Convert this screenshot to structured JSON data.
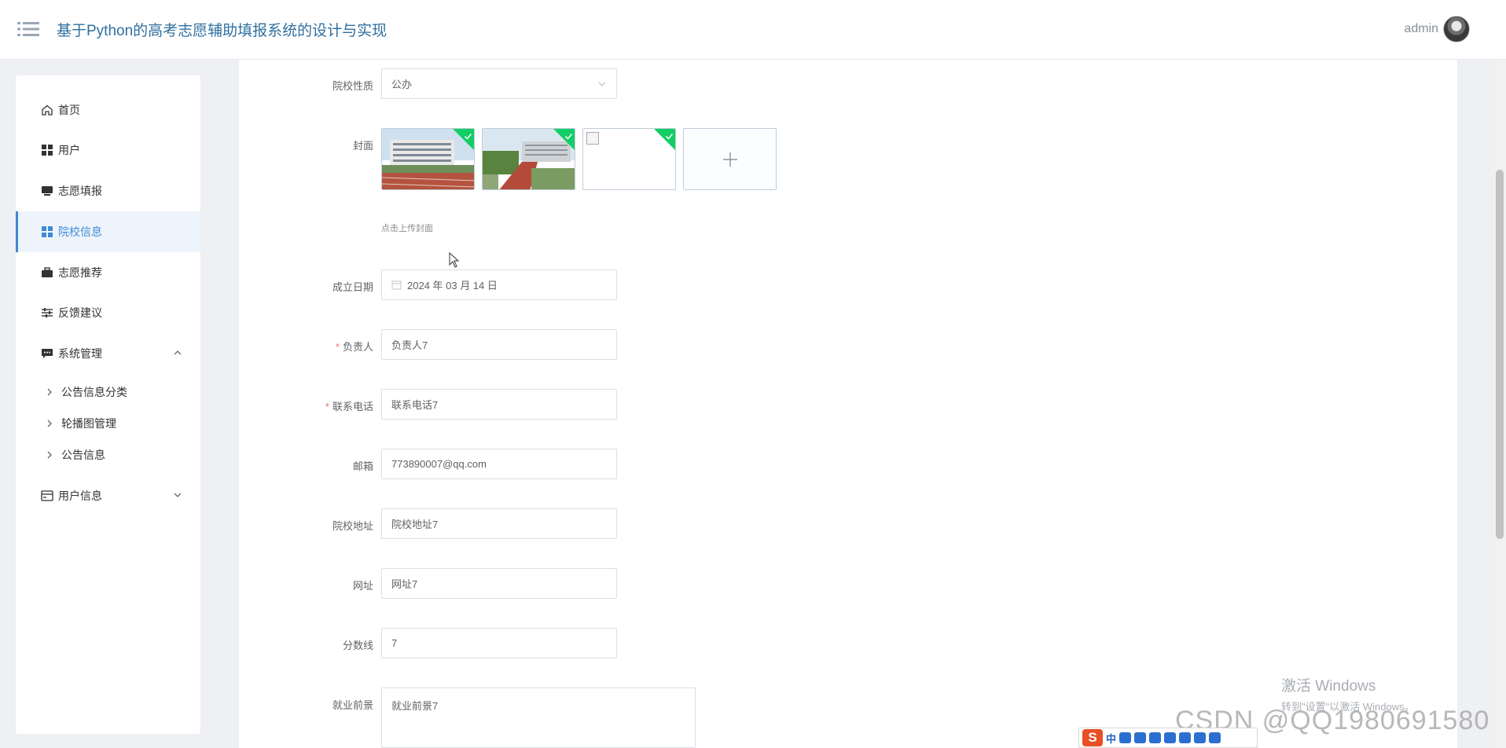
{
  "header": {
    "title": "基于Python的高考志愿辅助填报系统的设计与实现",
    "username": "admin"
  },
  "sidebar": {
    "items": [
      {
        "label": "首页",
        "icon": "home-icon"
      },
      {
        "label": "用户",
        "icon": "grid-icon"
      },
      {
        "label": "志愿填报",
        "icon": "monitor-icon"
      },
      {
        "label": "院校信息",
        "icon": "grid-icon",
        "active": true
      },
      {
        "label": "志愿推荐",
        "icon": "briefcase-icon"
      },
      {
        "label": "反馈建议",
        "icon": "sliders-icon"
      },
      {
        "label": "系统管理",
        "icon": "chat-icon",
        "expanded": true
      },
      {
        "label": "用户信息",
        "icon": "card-icon",
        "expanded": false
      }
    ],
    "sub_items": [
      "公告信息分类",
      "轮播图管理",
      "公告信息"
    ]
  },
  "form": {
    "nature_label": "院校性质",
    "nature_value": "公办",
    "cover_label": "封面",
    "cover_hint": "点击上传封面",
    "date_label": "成立日期",
    "date_value": "2024 年 03 月 14 日",
    "leader_label": "负责人",
    "leader_value": "负责人7",
    "phone_label": "联系电话",
    "phone_value": "联系电话7",
    "email_label": "邮箱",
    "email_value": "773890007@qq.com",
    "address_label": "院校地址",
    "address_value": "院校地址7",
    "site_label": "网址",
    "site_value": "网址7",
    "score_label": "分数线",
    "score_value": "7",
    "prospect_label": "就业前景",
    "prospect_value": "就业前景7",
    "required_mark": "*"
  },
  "overlay": {
    "win_line1": "激活 Windows",
    "win_line2": "转到\"设置\"以激活 Windows。",
    "csdn": "CSDN @QQ1980691580",
    "ime_logo": "S",
    "ime_lang": "中"
  },
  "colors": {
    "accent": "#3e8ad6",
    "title": "#2f6f9f",
    "success_corner": "#13ce66",
    "required": "#f56c6c"
  }
}
